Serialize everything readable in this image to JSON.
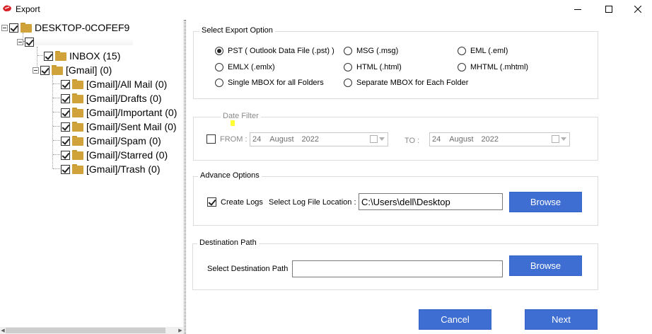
{
  "window": {
    "title": "Export"
  },
  "tree": {
    "root": "DESKTOP-0COFEF9",
    "folders": [
      "INBOX (15)",
      "[Gmail] (0)",
      "[Gmail]/All Mail (0)",
      "[Gmail]/Drafts (0)",
      "[Gmail]/Important (0)",
      "[Gmail]/Sent Mail (0)",
      "[Gmail]/Spam (0)",
      "[Gmail]/Starred (0)",
      "[Gmail]/Trash (0)"
    ]
  },
  "export_option": {
    "title": "Select Export Option",
    "selected": "PST ( Outlook Data File (.pst) )",
    "options": [
      "PST ( Outlook Data File (.pst) )",
      "MSG  (.msg)",
      "EML  (.eml)",
      "EMLX  (.emlx)",
      "HTML  (.html)",
      "MHTML (.mhtml)",
      "Single MBOX for all Folders",
      "Separate MBOX for Each Folder"
    ]
  },
  "date_filter": {
    "title": "Date Filter",
    "from_label": "FROM :",
    "to_label": "TO :",
    "from": {
      "day": "24",
      "month": "August",
      "year": "2022"
    },
    "to": {
      "day": "24",
      "month": "August",
      "year": "2022"
    },
    "enabled": false
  },
  "advance_options": {
    "title": "Advance Options",
    "create_logs_label": "Create Logs",
    "create_logs_checked": true,
    "log_location_label": "Select Log File Location :",
    "log_location_value": "C:\\Users\\dell\\Desktop",
    "browse_label": "Browse"
  },
  "destination": {
    "title": "Destination Path",
    "label": "Select Destination Path",
    "value": "",
    "browse_label": "Browse"
  },
  "footer": {
    "cancel_label": "Cancel",
    "next_label": "Next"
  },
  "colors": {
    "button": "#3e6ed2",
    "folder": "#cfa33a",
    "highlight": "#ffff33"
  }
}
